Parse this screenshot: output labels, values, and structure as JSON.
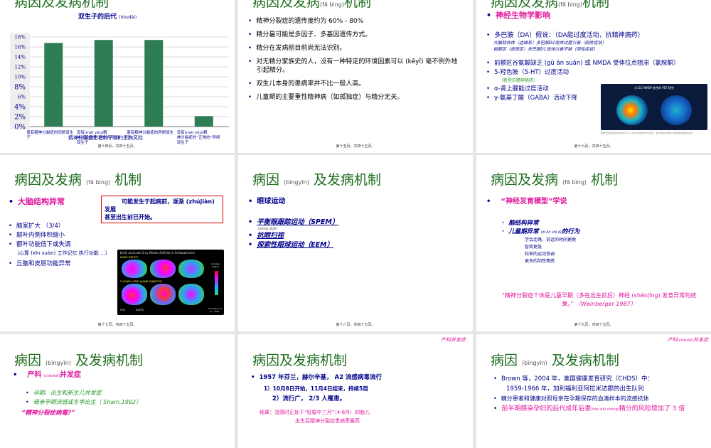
{
  "slides": {
    "s1": {
      "title": "病因及发病机制",
      "chart_title": "双生子的后代",
      "chart_title_py": "(hòudài)",
      "caption": "精神分裂症患者的子女的患病风险",
      "footer": "第十四页，共四十五页。"
    },
    "s2": {
      "title_main": "病因及发病",
      "title_py": "(fā bìng)",
      "title_tail": "机制",
      "bullets": [
        "精神分裂症的遗传度约为 60% - 80%",
        "精分最可能是多因子、多基因遗传方式。",
        "精分在发病前目前尚无法识别。",
        "对无精分家族史的人，没有一种特定的环境因素可以 (kěyǐ) 毫不例外地引起精分。",
        "双生儿本身的患病率并不比一般人高。",
        "儿童期的主要重性精神病（如孤独症）与精分无关。"
      ],
      "footer": "第十五页，共四十五页。"
    },
    "s3": {
      "title_main": "病因及发病",
      "title_py": "(fā bìng)",
      "title_tail": "机制",
      "heading": "神经生物学影响",
      "da_line": "多巴胺（DA）假说：（DA能过度活动，抗精神病药）",
      "da_sub1": "大脑较状体（边缘系）多巴胺D2受体过度兴奋（阳性症状）",
      "da_sub2": "前额区（皮质区）多巴胺D1受体兴奋不够（阴性症状）",
      "items": [
        "前额区谷氨酸缺乏 (gǔ ān suān) 或 NMDA 受体位点阻滞（氯胺酮）",
        "5-羟色胺（5-HT）过度活动",
        "（新型抗精神病药）",
        "α-肾上腺能过度活动",
        "γ-氨基丁酸（GABA）活动下降"
      ],
      "pet_title": "与11C-NMSP 结合的 PET 研究",
      "pet_caption": "精神分裂症患者治疗前后与 11C-NMSP 结合的PET研究：治疗前后多巴胺D2受体结合程度的变化",
      "footer": "第十六页，共四十五页。"
    },
    "s4": {
      "title_main": "病因及发病",
      "title_py": "(fā bìng)",
      "title_tail": "机制",
      "heading": "大脑结构异常",
      "redbox_l1": "可能发生于起病前，逐渐 (zhújiàn)",
      "redbox_l2": "发展",
      "redbox_l3": "甚至出生前已开始。",
      "items": [
        "脑室扩大 （3/4）",
        "颞叶内侧体积缩小",
        "额叶功能低下或失调"
      ],
      "paren": "（心算 (xīn suàn) 工作记忆 执行功能 …）",
      "last": "丘脑和皮层功能异常",
      "mri_title": "Early and Late Gray Matter Deficits in Schizophrenia",
      "mri_l1": "EARLY DEFICIT",
      "mri_l2": "5 YEARS LATER (SAME SUBJECTS)",
      "mri_l3": "STG",
      "mri_l4": "DLPFC",
      "mri_legend": "Average Deficit",
      "mri_credit": "Thompson et al., 2001",
      "footer": "第十七页，共四十五页。"
    },
    "s5": {
      "title_main": "病因",
      "title_py": "(bìngyīn)",
      "title_tail": "及发病机制",
      "heading": "眼球运动",
      "items": [
        "平衡眼跟踪运动（SPEM）",
        "抗眼扫视",
        "探索性眼球运动（EEM）"
      ],
      "item_py": "(zōng duō)",
      "footer": "第十八页，共四十五页。"
    },
    "s6": {
      "title_main": "病因及发病",
      "title_py": "(fā bìng)",
      "title_tail": "机制",
      "heading": "“神经发育模型”学说",
      "sub1": "脑结构异常",
      "sub2": "儿童期异常",
      "sub2_py": "(zǐ ěn shì ō)",
      "sub2_tail": "的行为",
      "detail": [
        "学会走路、说话的时间更晚",
        "智商更低",
        "较差的运动协调",
        "更多的阴性情感"
      ],
      "quote": "“精神分裂症个体是儿童早期（多在出生前后）神经 (shénjīng) 发育异常的结果。”",
      "cite": "（Weinberger 1987）",
      "footer": "第十九页，共四十五页。"
    },
    "s7": {
      "title_main": "病因",
      "title_py": "(bìngyīn)",
      "title_tail": "及发病机制",
      "heading": "产科",
      "heading_py": "(chǎnkē)",
      "heading_tail": "并发症",
      "items": [
        "孕期、出生和新生儿并发症",
        "母亲孕期流感或冬季出生（ Sham,1992）"
      ],
      "quote": "“精神分裂症病毒?”"
    },
    "s8": {
      "top_right": "产科并发症",
      "title": "病因及发病机制",
      "l1": "1957 年芬兰，赫尔辛基， A2 流感病毒流行",
      "l2": "1）10月8日开始，11月4日结束，持续5周",
      "l3": "2）流行广， 2/3 人罹患。",
      "l4": "结果：流感时正处于“妊娠中三月”（4-6月）的胎儿",
      "l5": "出生后精神分裂症患病率最高"
    },
    "s9": {
      "top_right": "产科",
      "top_right_py": "(chǎnkē)",
      "top_right_tail": "并发症",
      "title_main": "病因",
      "title_py": "(bìngyīn)",
      "title_tail": "及发病机制",
      "b1": "Brown 等，2004 年，美国健康发育研究（CHDS）中：",
      "b1b": "1959-1966 年，加利福利亚阿拉米达郡的出生队列",
      "b2": "精分患者和健康对照母亲在孕期保存的血清样本的流感抗体",
      "b3": "前半期感染孕妇的后代成年后患",
      "b3_py": "(hòu dài chéng)",
      "b3_tail": "精分的风险增加了 3 倍"
    }
  },
  "chart_data": {
    "type": "bar",
    "title": "双生子的后代 (hòudài)",
    "categories": [
      "患有精神分裂症的同卵双生子",
      "没有(méi yǒu)精神分裂症的“正常的”同卵双生子",
      "患有精神分裂症的异卵双生子",
      "没有(méi yǒu)精神分裂症的“正常的”异卵双生子"
    ],
    "values": [
      16.8,
      17.4,
      17.4,
      2.1
    ],
    "ylim": [
      0,
      18
    ],
    "yticks": [
      "0%",
      "2%",
      "4%",
      "6%",
      "8%",
      "10%",
      "12%",
      "14%",
      "16%",
      "18%"
    ],
    "xlabel": "精神分裂症患者的子女的患病风险",
    "grid": true,
    "bar_color": "#2e7d55"
  }
}
